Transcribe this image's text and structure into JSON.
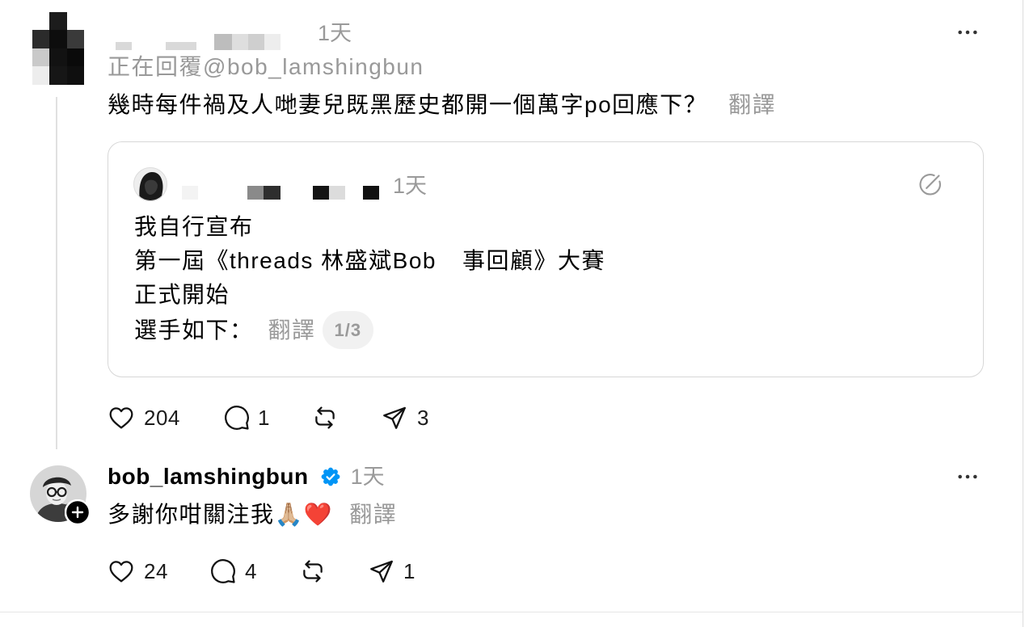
{
  "reply_post": {
    "timestamp": "1天",
    "replying_prefix": "正在回覆",
    "replying_handle": "@bob_lamshingbun",
    "text": "幾時每件禍及人哋妻兒既黑歷史都開一個萬字po回應下？",
    "translate_label": "翻譯",
    "quoted_post": {
      "timestamp": "1天",
      "line_1": "我自行宣布",
      "line_2_before_redaction": "第一屆《threads 林盛斌Bob",
      "line_2_after_redaction": "事回顧》大賽",
      "line_3": "正式開始",
      "line_4": "選手如下：",
      "translate_label": "翻譯",
      "media_counter": "1/3"
    },
    "stats": {
      "likes": "204",
      "replies": "1",
      "shares": "3"
    }
  },
  "author_post": {
    "username": "bob_lamshingbun",
    "verified": true,
    "timestamp": "1天",
    "text": "多謝你咁關注我🙏🏼❤️",
    "translate_label": "翻譯",
    "stats": {
      "likes": "24",
      "replies": "4",
      "shares": "1"
    }
  },
  "icons": {
    "more": "more-icon",
    "like": "heart-icon",
    "reply": "comment-icon",
    "repost": "repost-icon",
    "share": "share-icon",
    "verified": "verified-badge-icon",
    "follow": "plus-icon",
    "quoted_indicator": "edit-icon"
  },
  "colors": {
    "text": "#000000",
    "secondary_text": "#999999",
    "verified_badge": "#0095f6",
    "card_border": "#d7d7d7",
    "thread_line": "#e0e0e0",
    "pill_background": "#f1f1f1"
  }
}
